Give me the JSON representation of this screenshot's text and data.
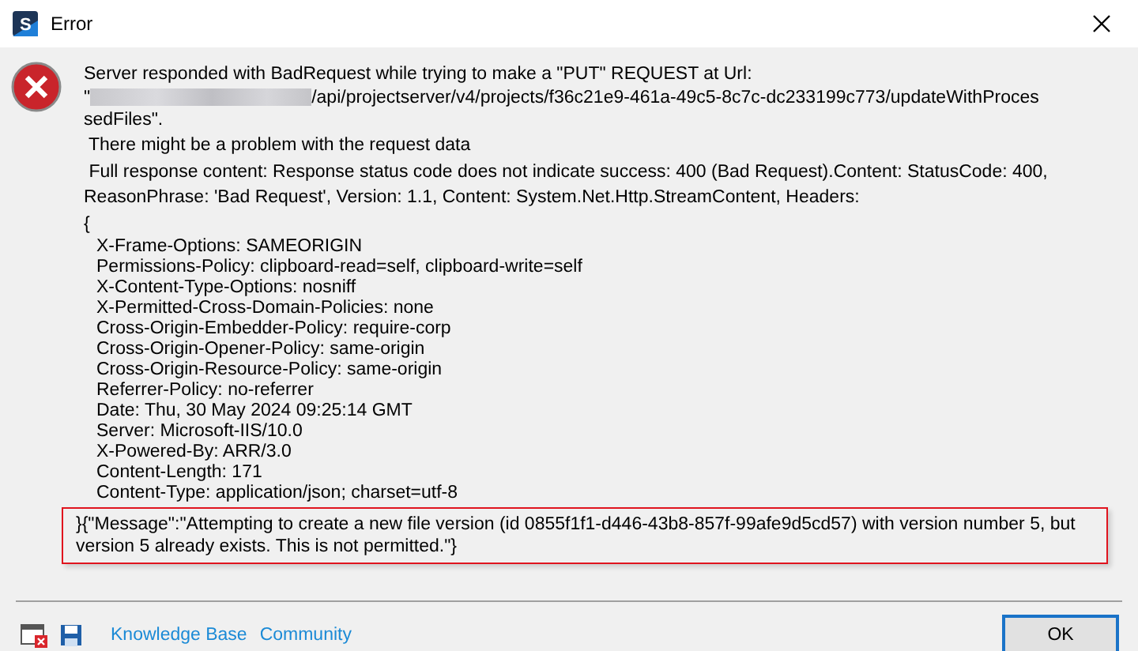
{
  "window": {
    "logo_letter": "S",
    "title": "Error"
  },
  "intro_lines": [
    {
      "kind": "text",
      "text": "Server responded with BadRequest while trying to make a \"PUT\" REQUEST at Url:"
    },
    {
      "kind": "url",
      "before": "\"",
      "after": "/api/projectserver/v4/projects/f36c21e9-461a-49c5-8c7c-dc233199c773/updateWithProces"
    },
    {
      "kind": "text",
      "text": "sedFiles\"."
    },
    {
      "kind": "text",
      "text": " There might be a problem with the request data"
    },
    {
      "kind": "text",
      "text": " Full response content: Response status code does not indicate success: 400 (Bad Request).Content: StatusCode: 400,"
    },
    {
      "kind": "text",
      "text": "ReasonPhrase: 'Bad Request', Version: 1.1, Content: System.Net.Http.StreamContent, Headers:"
    },
    {
      "kind": "text",
      "text": "{"
    }
  ],
  "header_lines": [
    "X-Frame-Options: SAMEORIGIN",
    "Permissions-Policy: clipboard-read=self, clipboard-write=self",
    "X-Content-Type-Options: nosniff",
    "X-Permitted-Cross-Domain-Policies: none",
    "Cross-Origin-Embedder-Policy: require-corp",
    "Cross-Origin-Opener-Policy: same-origin",
    "Cross-Origin-Resource-Policy: same-origin",
    "Referrer-Policy: no-referrer",
    "Date: Thu, 30 May 2024 09:25:14 GMT",
    "Server: Microsoft-IIS/10.0",
    "X-Powered-By: ARR/3.0",
    "Content-Length: 171",
    "Content-Type: application/json; charset=utf-8"
  ],
  "highlighted_lines": [
    "}{\"Message\":\"Attempting to create a new file version (id 0855f1f1-d446-43b8-857f-99afe9d5cd57) with version number 5, but",
    "version 5 already exists. This is not permitted.\"}"
  ],
  "footer": {
    "links": [
      "Knowledge Base",
      "Community"
    ],
    "button": "OK"
  }
}
